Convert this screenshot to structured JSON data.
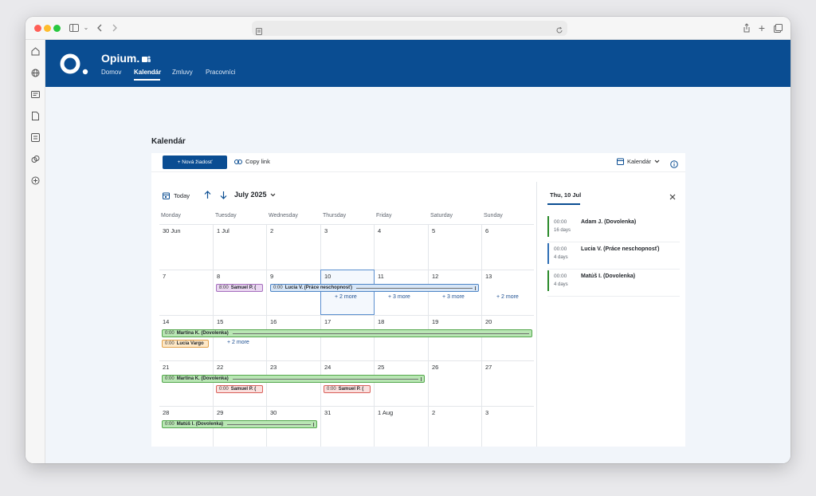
{
  "browser": {
    "url": ""
  },
  "app": {
    "brand": "Opium.",
    "nav": [
      "Domov",
      "Kalendár",
      "Zmluvy",
      "Pracovníci"
    ],
    "active_nav": "Kalendár"
  },
  "page": {
    "title": "Kalendár"
  },
  "toolbar": {
    "new_request": "+ Nová žiadosť",
    "copy_link": "Copy link",
    "view": "Kalendár"
  },
  "calendar": {
    "today_label": "Today",
    "month_label": "July 2025",
    "weekdays": [
      "Monday",
      "Tuesday",
      "Wednesday",
      "Thursday",
      "Friday",
      "Saturday",
      "Sunday"
    ],
    "weeks": [
      [
        "30 Jun",
        "1 Jul",
        "2",
        "3",
        "4",
        "5",
        "6"
      ],
      [
        "7",
        "8",
        "9",
        "10",
        "11",
        "12",
        "13"
      ],
      [
        "14",
        "15",
        "16",
        "17",
        "18",
        "19",
        "20"
      ],
      [
        "21",
        "22",
        "23",
        "24",
        "25",
        "26",
        "27"
      ],
      [
        "28",
        "29",
        "30",
        "31",
        "1 Aug",
        "2",
        "3"
      ]
    ],
    "events": {
      "w2_samuel": {
        "time": "8:00",
        "name": "Samuel P. ("
      },
      "w2_lucia": {
        "time": "0:00",
        "name": "Lucia V. (Práce neschopnosť)"
      },
      "w3_martina": {
        "time": "0:00",
        "name": "Martina K. (Dovolenka)"
      },
      "w3_lucia": {
        "time": "0:00",
        "name": "Lucia Vargo"
      },
      "w4_martina": {
        "time": "0:00",
        "name": "Martina K. (Dovolenka)"
      },
      "w4_samuel1": {
        "time": "0:00",
        "name": "Samuel P. ("
      },
      "w4_samuel2": {
        "time": "0:00",
        "name": "Samuel P. ("
      },
      "w5_matus": {
        "time": "0:00",
        "name": "Matúš I. (Dovolenka)"
      }
    },
    "more": {
      "w2_thu": "+ 2 more",
      "w2_fri": "+ 3 more",
      "w2_sat": "+ 3 more",
      "w2_sun": "+ 2 more",
      "w3_tue": "+ 2 more"
    }
  },
  "panel": {
    "date": "Thu, 10 Jul",
    "items": [
      {
        "time": "00:00",
        "duration": "16 days",
        "title": "Adam J. (Dovolenka)",
        "color": "#2a8a2a"
      },
      {
        "time": "00:00",
        "duration": "4 days",
        "title": "Lucia V. (Práce neschopnosť)",
        "color": "#2f6fb5"
      },
      {
        "time": "00:00",
        "duration": "4 days",
        "title": "Matúš I. (Dovolenka)",
        "color": "#2a8a2a"
      }
    ]
  },
  "colors": {
    "brand": "#0a4d92",
    "page_bg": "#f1f5fa"
  }
}
